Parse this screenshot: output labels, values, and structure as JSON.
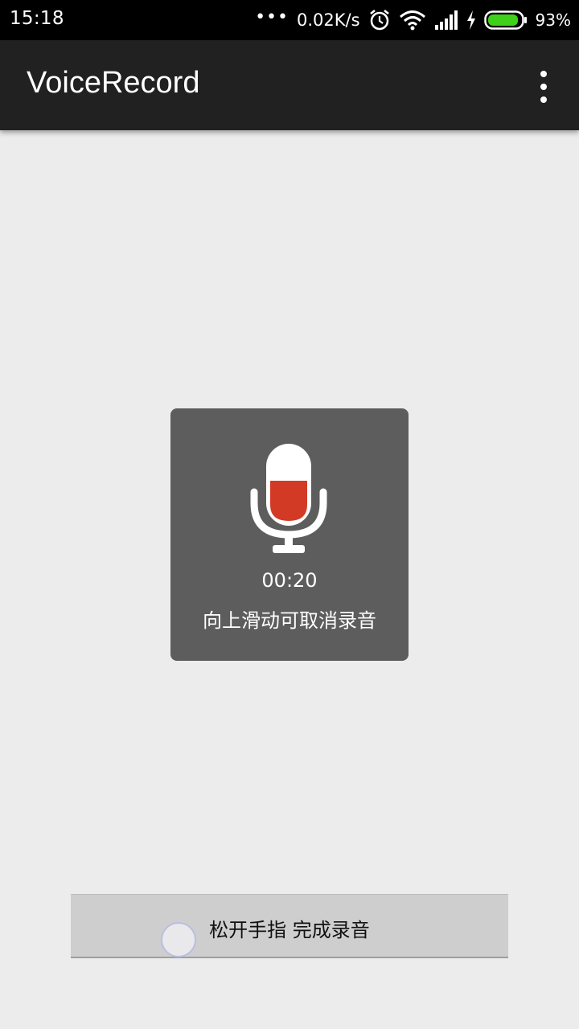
{
  "status_bar": {
    "time": "15:18",
    "more_dots": "•••",
    "net_speed": "0.02K/s",
    "battery_percent": "93%",
    "battery_level": 0.93,
    "icons": [
      "alarm-icon",
      "wifi-icon",
      "signal-icon",
      "charging-icon",
      "battery-icon"
    ]
  },
  "app_bar": {
    "title": "VoiceRecord",
    "menu_icon": "overflow-menu-icon"
  },
  "record_dialog": {
    "icon": "microphone-icon",
    "level_color": "#d23a26",
    "elapsed": "00:20",
    "hint": "向上滑动可取消录音"
  },
  "record_button": {
    "label": "松开手指 完成录音"
  },
  "colors": {
    "status_bar_bg": "#000000",
    "app_bar_bg": "#212121",
    "page_bg": "#ececec",
    "dialog_bg": "#5d5d5d",
    "button_bg": "#cecece",
    "battery_fill": "#3fd11a"
  }
}
